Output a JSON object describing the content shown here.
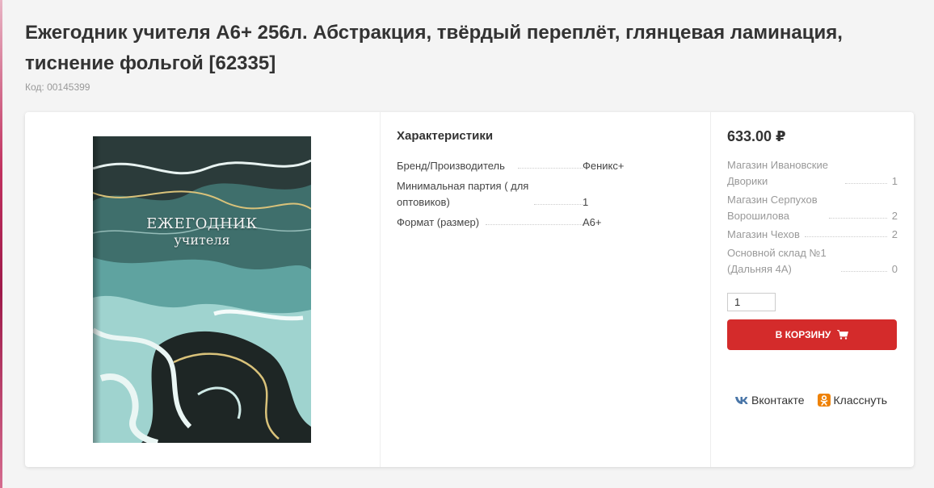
{
  "product": {
    "title": "Ежегодник учителя А6+ 256л. Абстракция, твёрдый переплёт, глянцевая ламинация, тиснение фольгой [62335]",
    "code": "Код: 00145399"
  },
  "image": {
    "cover_title": "ЕЖЕГОДНИК",
    "cover_subtitle": "учителя"
  },
  "specs": {
    "title": "Характеристики",
    "rows": [
      {
        "label": "Бренд/Производитель",
        "value": "Феникс+"
      },
      {
        "label": "Минимальная партия ( для оптовиков)",
        "value": "1"
      },
      {
        "label": "Формат (размер)",
        "value": "А6+"
      }
    ]
  },
  "buy": {
    "price": "633.00 ₽",
    "stores": [
      {
        "name": "Магазин Ивановские Дворики",
        "qty": "1"
      },
      {
        "name": "Магазин Серпухов Ворошилова",
        "qty": "2"
      },
      {
        "name": "Магазин Чехов",
        "qty": "2"
      },
      {
        "name": "Основной склад №1 (Дальняя 4А)",
        "qty": "0"
      }
    ],
    "quantity": "1",
    "cart_label": "В КОРЗИНУ"
  },
  "social": {
    "vk_label": "Вконтакте",
    "ok_label": "Класснуть"
  },
  "colors": {
    "accent": "#d42b2b",
    "ok_brand": "#ee8208",
    "vk_brand": "#4a76a8"
  }
}
